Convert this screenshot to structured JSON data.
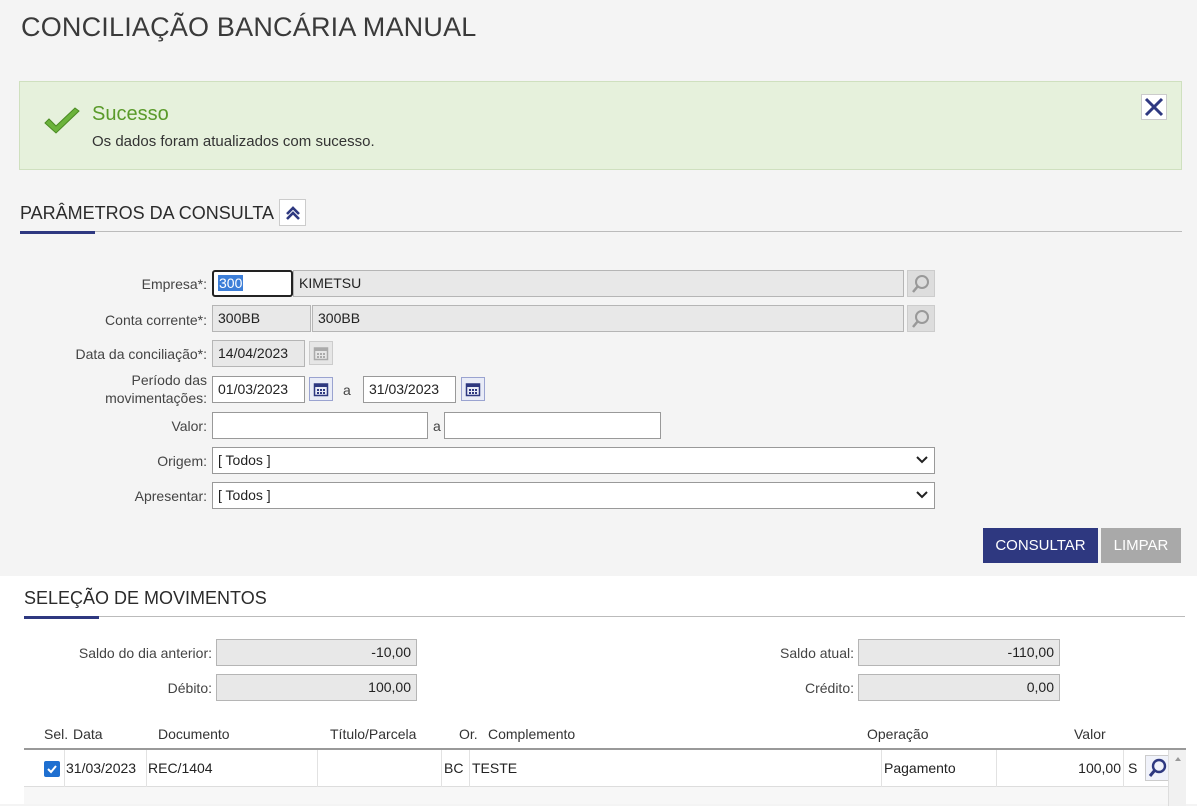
{
  "page": {
    "title": "CONCILIAÇÃO BANCÁRIA MANUAL"
  },
  "alert": {
    "title": "Sucesso",
    "message": "Os dados foram atualizados com sucesso."
  },
  "params": {
    "section_title": "PARÂMETROS DA CONSULTA",
    "empresa": {
      "label": "Empresa*:",
      "code": "300",
      "name": "KIMETSU"
    },
    "conta": {
      "label": "Conta corrente*:",
      "code": "300BB",
      "name": "300BB"
    },
    "data_conciliacao": {
      "label": "Data da conciliação*:",
      "value": "14/04/2023"
    },
    "periodo": {
      "label_line1": "Período das",
      "label_line2": "movimentações:",
      "from": "01/03/2023",
      "sep": "a",
      "to": "31/03/2023"
    },
    "valor": {
      "label": "Valor:",
      "from": "",
      "sep": "a",
      "to": ""
    },
    "origem": {
      "label": "Origem:",
      "value": "[ Todos ]"
    },
    "apresentar": {
      "label": "Apresentar:",
      "value": "[ Todos ]"
    },
    "consultar_label": "CONSULTAR",
    "limpar_label": "LIMPAR"
  },
  "movimentos": {
    "section_title": "SELEÇÃO DE MOVIMENTOS",
    "saldo_anterior": {
      "label": "Saldo do dia anterior:",
      "value": "-10,00"
    },
    "debito": {
      "label": "Débito:",
      "value": "100,00"
    },
    "saldo_atual": {
      "label": "Saldo atual:",
      "value": "-110,00"
    },
    "credito": {
      "label": "Crédito:",
      "value": "0,00"
    },
    "columns": {
      "sel": "Sel.",
      "data": "Data",
      "documento": "Documento",
      "titulo": "Título/Parcela",
      "or": "Or.",
      "complemento": "Complemento",
      "operacao": "Operação",
      "valor": "Valor"
    },
    "rows": [
      {
        "data": "31/03/2023",
        "documento": "REC/1404",
        "titulo": "",
        "or": "BC",
        "complemento": "TESTE",
        "operacao": "Pagamento",
        "valor": "100,00",
        "flag": "S"
      }
    ]
  },
  "colors": {
    "primary": "#2e3880",
    "success": "#5a9a2a",
    "alert_bg": "#e6f1dc"
  }
}
